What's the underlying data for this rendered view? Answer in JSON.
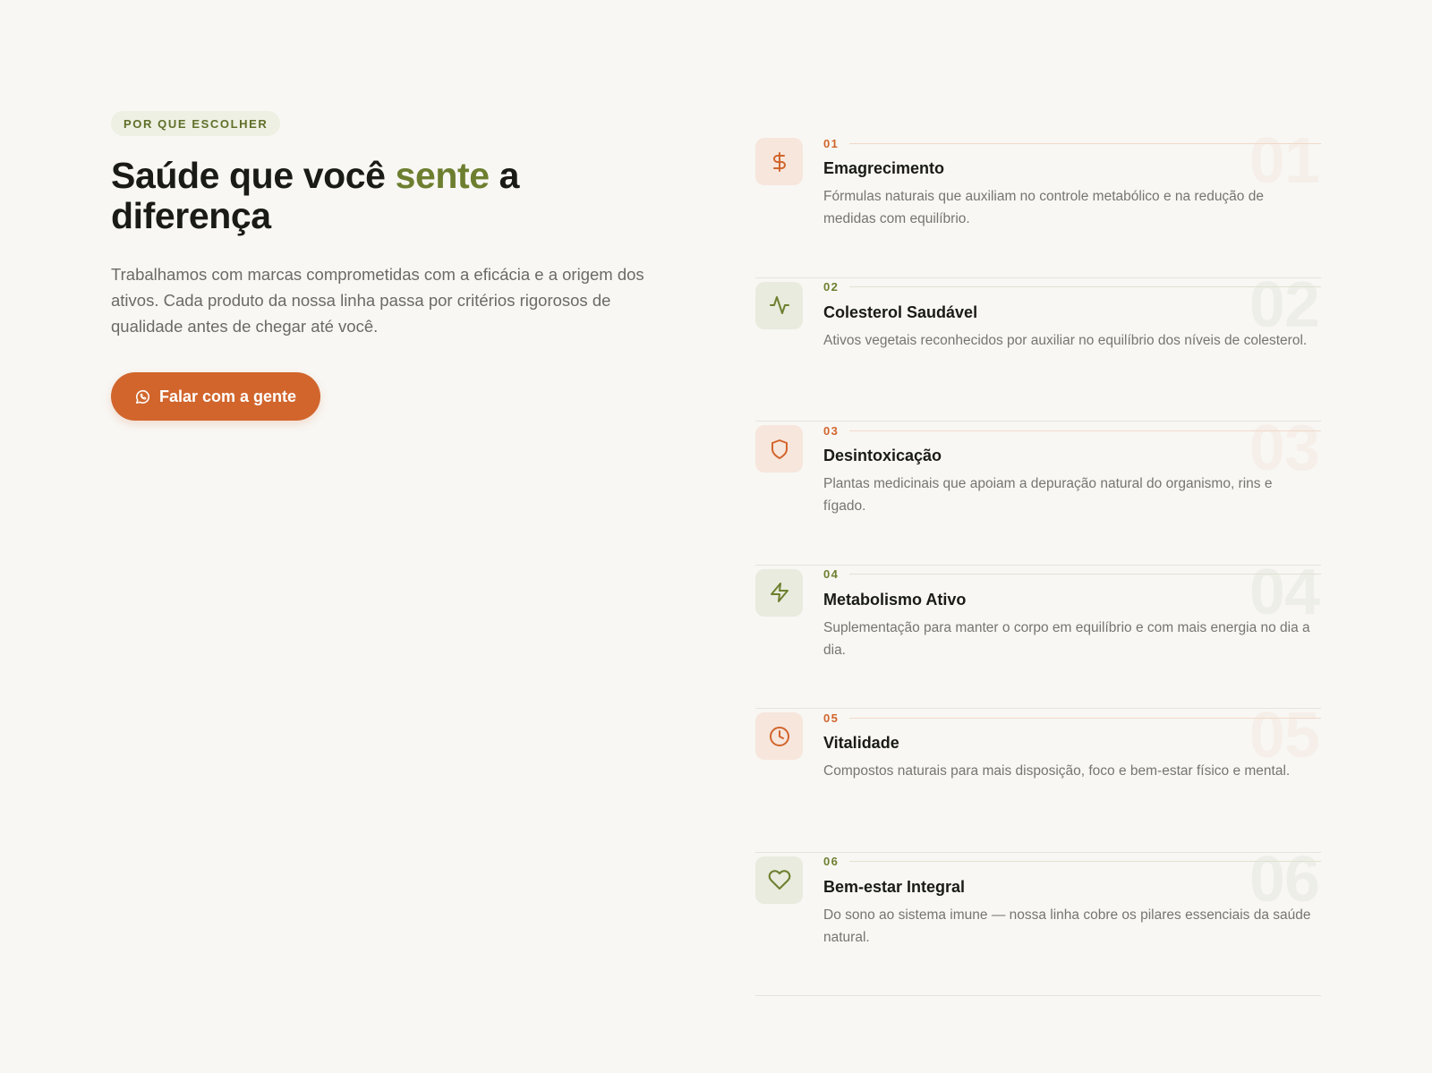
{
  "colors": {
    "background": "#f8f7f4",
    "accent_orange": "#d1652c",
    "accent_green": "#6d7f2f",
    "heading": "#1a1b16",
    "body_text": "#6b6a66"
  },
  "intro": {
    "eyebrow": "POR QUE ESCOLHER",
    "headline_part1": "Saúde que você ",
    "headline_accent": "sente",
    "headline_part2": " a diferença",
    "lede": "Trabalhamos com marcas comprometidas com a eficácia e a origem dos ativos. Cada produto da nossa linha passa por critérios rigorosos de qualidade antes de chegar até você.",
    "cta_label": "Falar com a gente",
    "cta_icon": "whatsapp-icon"
  },
  "features": [
    {
      "number": "01",
      "title": "Emagrecimento",
      "description": "Fórmulas naturais que auxiliam no controle metabólico e na redução de medidas com equilíbrio.",
      "icon": "dollar-icon",
      "tone": "orange"
    },
    {
      "number": "02",
      "title": "Colesterol Saudável",
      "description": "Ativos vegetais reconhecidos por auxiliar no equilíbrio dos níveis de colesterol.",
      "icon": "activity-icon",
      "tone": "green"
    },
    {
      "number": "03",
      "title": "Desintoxicação",
      "description": "Plantas medicinais que apoiam a depuração natural do organismo, rins e fígado.",
      "icon": "shield-icon",
      "tone": "orange"
    },
    {
      "number": "04",
      "title": "Metabolismo Ativo",
      "description": "Suplementação para manter o corpo em equilíbrio e com mais energia no dia a dia.",
      "icon": "lightning-icon",
      "tone": "green"
    },
    {
      "number": "05",
      "title": "Vitalidade",
      "description": "Compostos naturais para mais disposição, foco e bem-estar físico e mental.",
      "icon": "clock-icon",
      "tone": "orange"
    },
    {
      "number": "06",
      "title": "Bem-estar Integral",
      "description": "Do sono ao sistema imune — nossa linha cobre os pilares essenciais da saúde natural.",
      "icon": "heart-icon",
      "tone": "green"
    }
  ]
}
